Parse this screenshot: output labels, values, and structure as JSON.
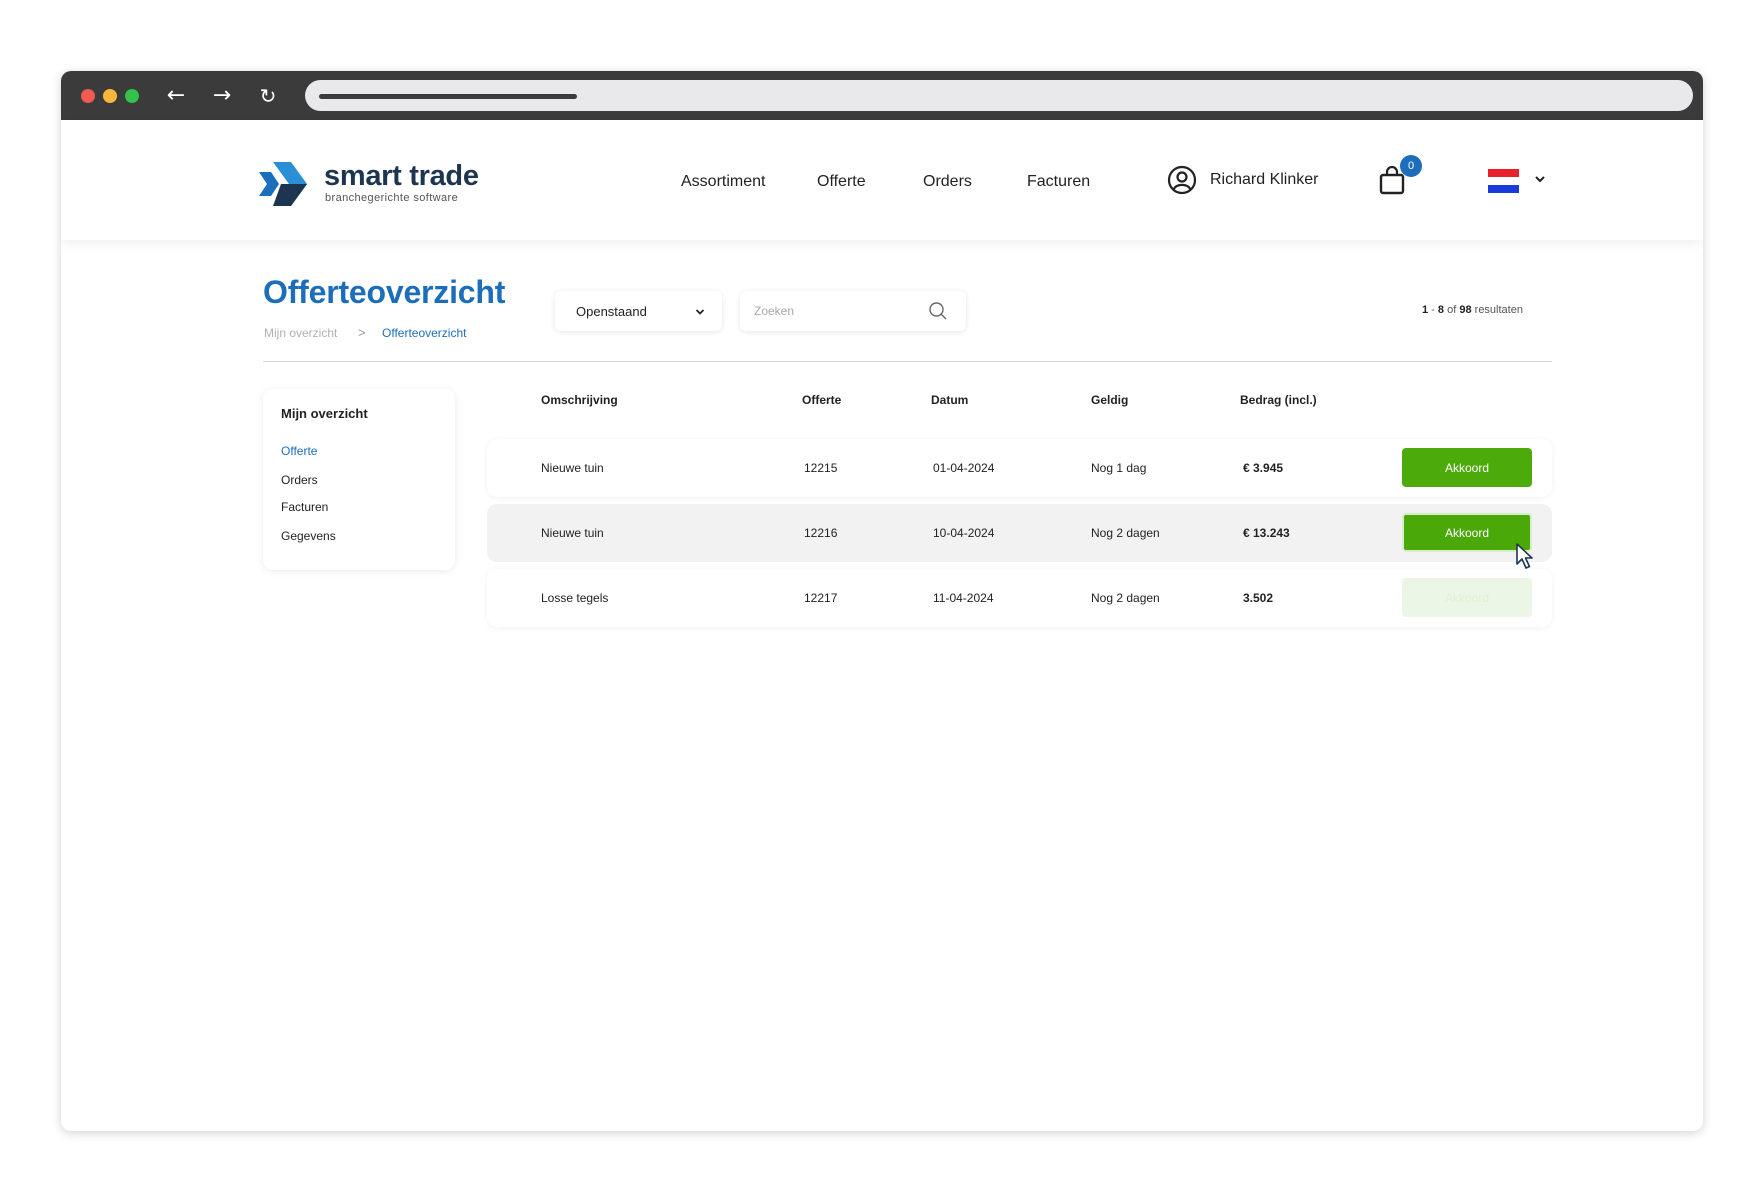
{
  "brand": {
    "name": "smart trade",
    "tagline": "branchegerichte software",
    "color": "#1d3550"
  },
  "nav": {
    "links": [
      "Assortiment",
      "Offerte",
      "Orders",
      "Facturen"
    ]
  },
  "user": {
    "name": "Richard Klinker",
    "icon": "user-circle-icon"
  },
  "cart": {
    "count": "0",
    "icon": "shopping-bag-icon"
  },
  "language": {
    "flag": "netherlands-flag",
    "colors": [
      "#e8202b",
      "#ffffff",
      "#1a3bdc"
    ]
  },
  "page": {
    "title": "Offerteoverzicht",
    "breadcrumb": {
      "home": "Mijn overzicht",
      "separator": ">",
      "current": "Offerteoverzicht"
    }
  },
  "filters": {
    "status": "Openstaand",
    "search_placeholder": "Zoeken",
    "results": {
      "from": "1",
      "to": "8",
      "of_label": "of",
      "total": "98",
      "suffix": "resultaten"
    }
  },
  "sidebar": {
    "title": "Mijn overzicht",
    "items": [
      {
        "label": "Offerte",
        "active": true
      },
      {
        "label": "Orders",
        "active": false
      },
      {
        "label": "Facturen",
        "active": false
      },
      {
        "label": "Gegevens",
        "active": false
      }
    ]
  },
  "table": {
    "columns": [
      "Omschrijving",
      "Offerte",
      "Datum",
      "Geldig",
      "Bedrag (incl.)"
    ],
    "rows": [
      {
        "omschrijving": "Nieuwe tuin",
        "offerte": "12215",
        "datum": "01-04-2024",
        "geldig": "Nog 1 dag",
        "bedrag": "€ 3.945",
        "action": "Akkoord",
        "state": "enabled"
      },
      {
        "omschrijving": "Nieuwe tuin",
        "offerte": "12216",
        "datum": "10-04-2024",
        "geldig": "Nog 2 dagen",
        "bedrag": "€ 13.243",
        "action": "Akkoord",
        "state": "hover"
      },
      {
        "omschrijving": "Losse tegels",
        "offerte": "12217",
        "datum": "11-04-2024",
        "geldig": "Nog 2 dagen",
        "bedrag": "3.502",
        "action": "Akkoord",
        "state": "disabled"
      }
    ]
  },
  "colors": {
    "accent": "#1d6eba",
    "action_green": "#4caa0a",
    "chrome": "#3b3b3b"
  }
}
